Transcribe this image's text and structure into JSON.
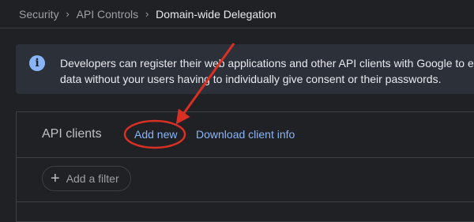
{
  "breadcrumb": {
    "items": [
      "Security",
      "API Controls"
    ],
    "current": "Domain-wide Delegation",
    "separator_icon": "chevron-right-icon"
  },
  "info_banner": {
    "icon": "info-icon",
    "line1": "Developers can register their web applications and other API clients with Google to e",
    "line2": "data without your users having to individually give consent or their passwords."
  },
  "clients": {
    "title": "API clients",
    "add_new": "Add new",
    "download": "Download client info",
    "filter_label": "Add a filter",
    "filter_icon": "plus-icon"
  },
  "colors": {
    "background": "#202124",
    "accent": "#8ab4f8",
    "annotation": "#d93025"
  }
}
